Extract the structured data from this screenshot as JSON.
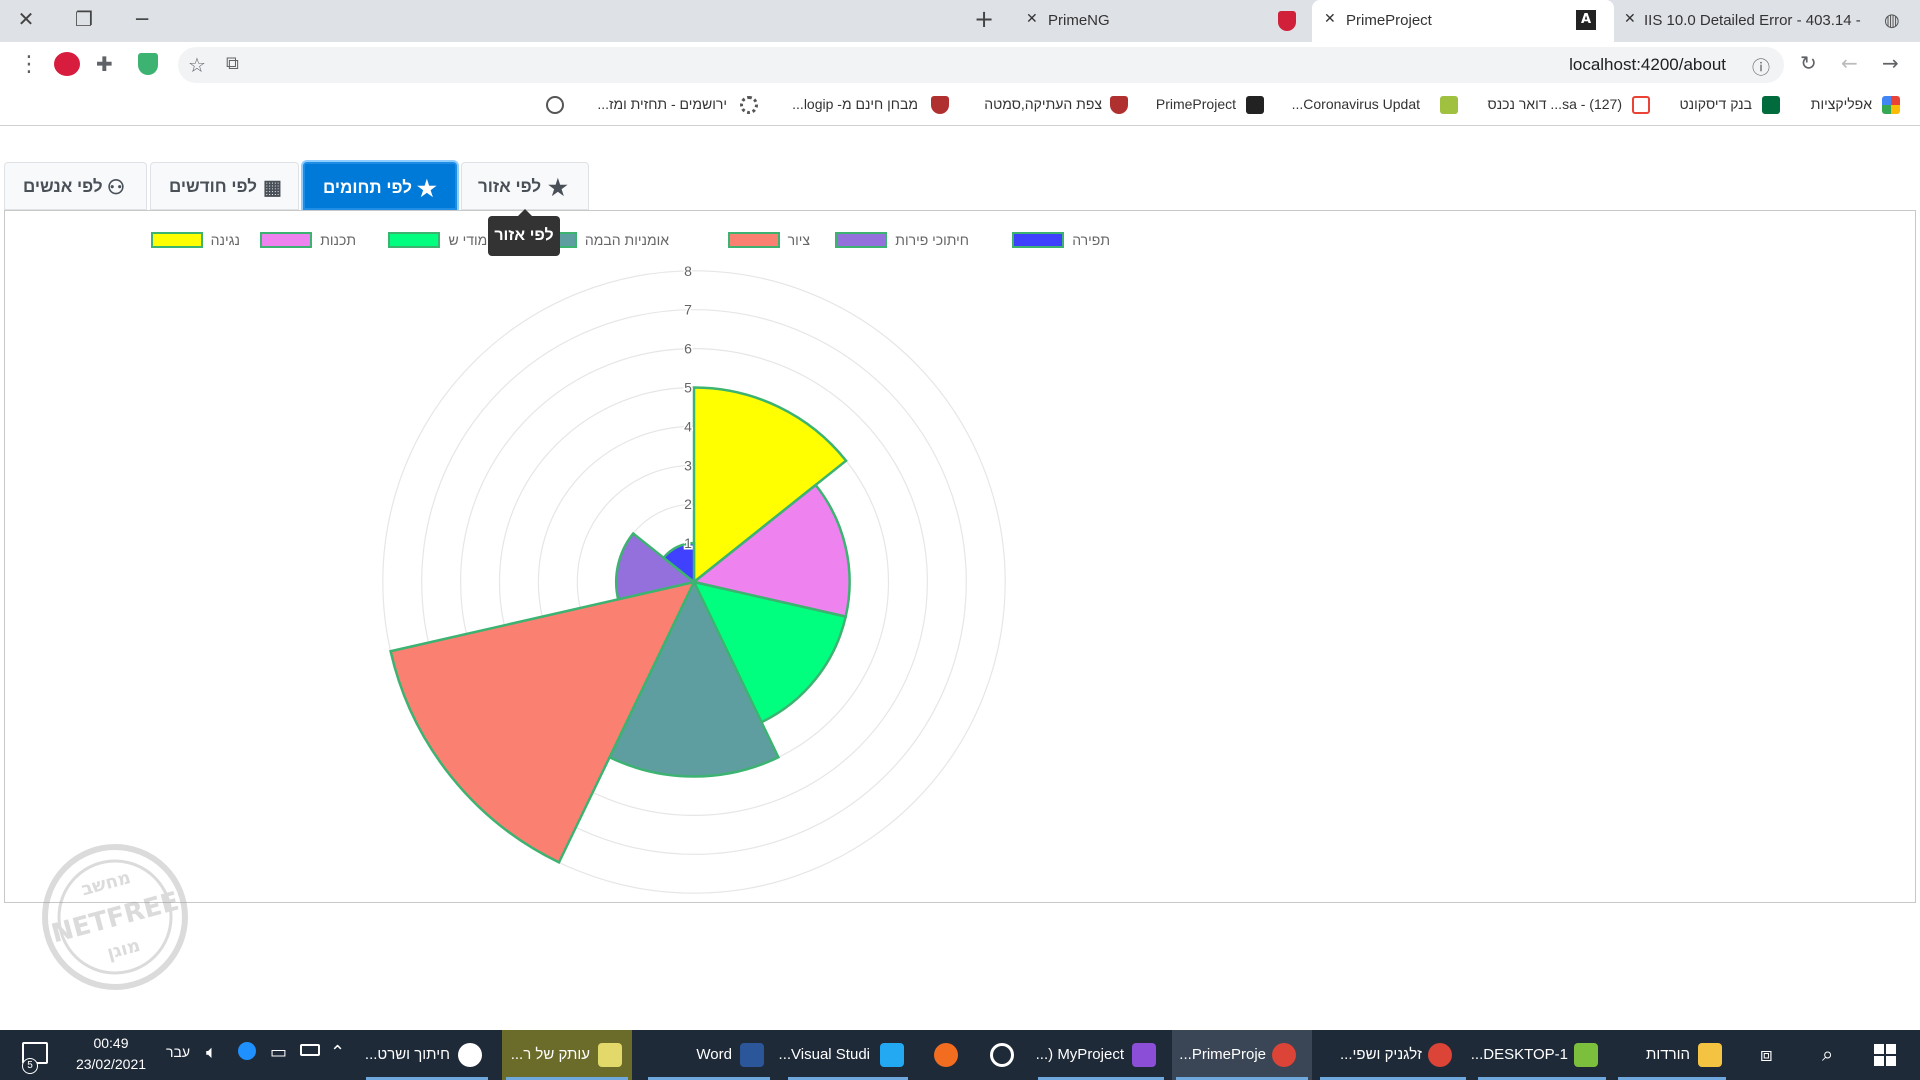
{
  "browser": {
    "tabs": [
      {
        "title": "IIS 10.0 Detailed Error - 403.14 -",
        "active": false
      },
      {
        "title": "PrimeProject",
        "active": true
      },
      {
        "title": "PrimeNG",
        "active": false
      }
    ],
    "new_tab_icon": "plus-icon",
    "url": "localhost:4200/about",
    "bookmarks": [
      "אפליקציות",
      "בנק דיסקונט",
      "(127) - sa... דואר נכנס",
      "Coronavirus Updat...",
      "PrimeProject",
      "צפת העתיקה,סמטה",
      "מבחן חינם מ- logip...",
      "ירושמים - תחזית ומז..."
    ]
  },
  "page": {
    "tabs": [
      {
        "label": "לפי אזור",
        "icon": "star-icon",
        "active": false
      },
      {
        "label": "לפי תחומים",
        "icon": "star-icon",
        "active": true
      },
      {
        "label": "לפי חודשים",
        "icon": "calendar-icon",
        "active": false
      },
      {
        "label": "לפי אנשים",
        "icon": "users-icon",
        "active": false
      }
    ],
    "tooltip": "לפי אזור"
  },
  "chart_data": {
    "type": "polarArea",
    "labels": [
      "נגינה",
      "תכנות",
      "לימודי שירה",
      "אומניות הבמה",
      "ציור",
      "חיתוכי פירות",
      "תפירה"
    ],
    "legend_labels": [
      "נגינה",
      "תכנות",
      "לימודי ש",
      "אומניות הבמה",
      "ציור",
      "חיתוכי פירות",
      "תפירה"
    ],
    "values": [
      5,
      4,
      4,
      5,
      8,
      2,
      1
    ],
    "colors": [
      "#ffff00",
      "#ee82ee",
      "#00ff7f",
      "#5f9ea0",
      "#fa8072",
      "#9370db",
      "#4040ff"
    ],
    "border_color": "#3cb371",
    "scale": {
      "min": 0,
      "max": 8,
      "ticks": [
        1,
        2,
        3,
        4,
        5,
        6,
        7,
        8
      ]
    },
    "legend_position": "top"
  },
  "taskbar": {
    "items": [
      "הורדות",
      "DESKTOP-1...",
      "זלגניק ושפי...",
      "PrimeProje...",
      "MyProject (...",
      "",
      "",
      "Visual Studi...",
      "Word",
      "עותק של ר...",
      "חיתוך ושרט..."
    ],
    "language": "עבר",
    "time": "00:49",
    "date": "23/02/2021",
    "notifications": "5"
  },
  "watermark": {
    "text": "NETFREE",
    "top": "מחשב",
    "bottom": "מוגן"
  }
}
